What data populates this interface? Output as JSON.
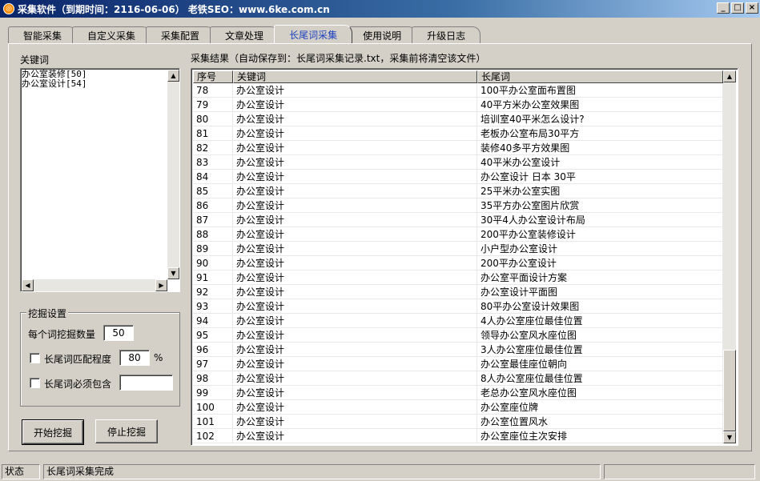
{
  "window": {
    "title": "采集软件（到期时间：2116-06-06）  老铁SEO：www.6ke.com.cn",
    "minimize": "_",
    "maximize": "□",
    "close": "×"
  },
  "tabs": [
    {
      "label": "智能采集"
    },
    {
      "label": "自定义采集"
    },
    {
      "label": "采集配置"
    },
    {
      "label": "文章处理"
    },
    {
      "label": "长尾词采集",
      "active": true
    },
    {
      "label": "使用说明"
    },
    {
      "label": "升级日志"
    }
  ],
  "keywords": {
    "label": "关键词",
    "items": [
      "办公室装修[50]",
      "办公室设计[54]"
    ]
  },
  "settings": {
    "title": "挖掘设置",
    "count_label": "每个词挖掘数量",
    "count_value": "50",
    "match_label": "长尾词匹配程度",
    "match_value": "80",
    "match_unit": "%",
    "must_contain_label": "长尾词必须包含",
    "must_contain_value": ""
  },
  "buttons": {
    "start": "开始挖掘",
    "stop": "停止挖掘"
  },
  "results": {
    "caption": "采集结果（自动保存到：长尾词采集记录.txt，采集前将清空该文件）",
    "columns": [
      "序号",
      "关键词",
      "长尾词"
    ],
    "rows": [
      [
        "78",
        "办公室设计",
        "100平办公室面布置图"
      ],
      [
        "79",
        "办公室设计",
        "40平方米办公室效果图"
      ],
      [
        "80",
        "办公室设计",
        "培训室40平米怎么设计?"
      ],
      [
        "81",
        "办公室设计",
        "老板办公室布局30平方"
      ],
      [
        "82",
        "办公室设计",
        "装修40多平方效果图"
      ],
      [
        "83",
        "办公室设计",
        "40平米办公室设计"
      ],
      [
        "84",
        "办公室设计",
        "办公室设计 日本 30平"
      ],
      [
        "85",
        "办公室设计",
        "25平米办公室实图"
      ],
      [
        "86",
        "办公室设计",
        "35平方办公室图片欣赏"
      ],
      [
        "87",
        "办公室设计",
        "30平4人办公室设计布局"
      ],
      [
        "88",
        "办公室设计",
        "200平办公室装修设计"
      ],
      [
        "89",
        "办公室设计",
        "小户型办公室设计"
      ],
      [
        "90",
        "办公室设计",
        "200平办公室设计"
      ],
      [
        "91",
        "办公室设计",
        "办公室平面设计方案"
      ],
      [
        "92",
        "办公室设计",
        "办公室设计平面图"
      ],
      [
        "93",
        "办公室设计",
        "80平办公室设计效果图"
      ],
      [
        "94",
        "办公室设计",
        "4人办公室座位最佳位置"
      ],
      [
        "95",
        "办公室设计",
        "领导办公室风水座位图"
      ],
      [
        "96",
        "办公室设计",
        "3人办公室座位最佳位置"
      ],
      [
        "97",
        "办公室设计",
        "办公室最佳座位朝向"
      ],
      [
        "98",
        "办公室设计",
        "8人办公室座位最佳位置"
      ],
      [
        "99",
        "办公室设计",
        "老总办公室风水座位图"
      ],
      [
        "100",
        "办公室设计",
        "办公室座位牌"
      ],
      [
        "101",
        "办公室设计",
        "办公室位置风水"
      ],
      [
        "102",
        "办公室设计",
        "办公室座位主次安排"
      ]
    ]
  },
  "status": {
    "label": "状态",
    "message": "长尾词采集完成"
  }
}
